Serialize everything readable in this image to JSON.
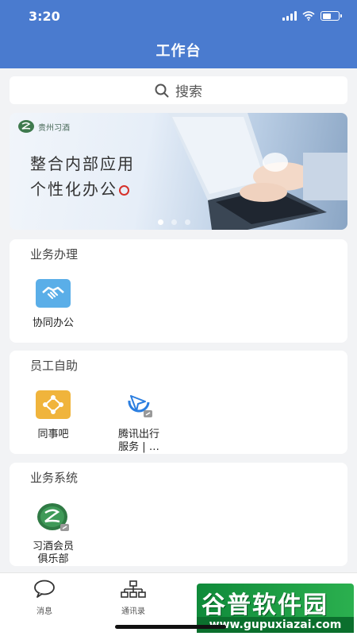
{
  "status_bar": {
    "time": "3:20"
  },
  "nav": {
    "title": "工作台"
  },
  "search": {
    "label": "搜索"
  },
  "banner": {
    "logo_text": "贵州习酒",
    "line1": "整合内部应用",
    "line2": "个性化办公",
    "slide_count": 3,
    "active_slide": 1
  },
  "sections": [
    {
      "title": "业务办理",
      "apps": [
        {
          "label": "协同办公",
          "icon": "handshake-icon"
        }
      ]
    },
    {
      "title": "员工自助",
      "apps": [
        {
          "label": "同事吧",
          "icon": "colleague-network-icon"
        },
        {
          "label": "腾讯出行服务 | …",
          "line1": "腾讯出行",
          "line2": "服务 | …",
          "icon": "tencent-travel-icon"
        }
      ]
    },
    {
      "title": "业务系统",
      "apps": [
        {
          "label": "习酒会员俱乐部",
          "line1": "习酒会员",
          "line2": "俱乐部",
          "icon": "xijiu-club-icon"
        }
      ]
    }
  ],
  "tabs": [
    {
      "label": "消息",
      "icon": "message-icon"
    },
    {
      "label": "通讯录",
      "icon": "contacts-org-icon"
    }
  ],
  "watermark": {
    "title": "谷普软件园",
    "url": "www.gupuxiazai.com"
  },
  "colors": {
    "primary": "#4a7bcf",
    "background": "#f2f3f5",
    "card": "#ffffff"
  }
}
